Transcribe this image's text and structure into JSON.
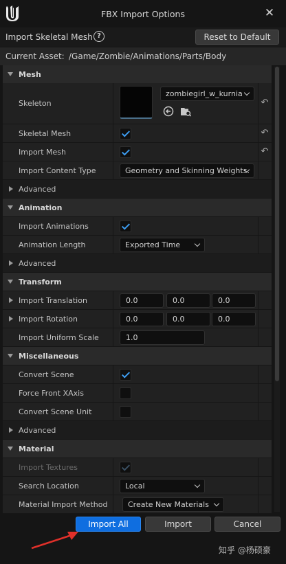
{
  "window": {
    "title": "FBX Import Options",
    "close_glyph": "✕"
  },
  "header": {
    "title": "Import Skeletal Mesh",
    "help_glyph": "?",
    "reset_label": "Reset to Default"
  },
  "asset": {
    "label": "Current Asset:",
    "path": "/Game/Zombie/Animations/Parts/Body"
  },
  "mesh": {
    "section": "Mesh",
    "skeleton_label": "Skeleton",
    "skeleton_value": "zombiegirl_w_kurnia",
    "skeletal_mesh_label": "Skeletal Mesh",
    "skeletal_mesh_checked": true,
    "import_mesh_label": "Import Mesh",
    "import_mesh_checked": true,
    "content_type_label": "Import Content Type",
    "content_type_value": "Geometry and Skinning Weights.",
    "advanced": "Advanced"
  },
  "animation": {
    "section": "Animation",
    "import_anims_label": "Import Animations",
    "import_anims_checked": true,
    "length_label": "Animation Length",
    "length_value": "Exported Time",
    "advanced": "Advanced"
  },
  "transform": {
    "section": "Transform",
    "translation_label": "Import Translation",
    "translation": [
      "0.0",
      "0.0",
      "0.0"
    ],
    "rotation_label": "Import Rotation",
    "rotation": [
      "0.0",
      "0.0",
      "0.0"
    ],
    "scale_label": "Import Uniform Scale",
    "scale": "1.0"
  },
  "misc": {
    "section": "Miscellaneous",
    "convert_scene_label": "Convert Scene",
    "convert_scene_checked": true,
    "force_front_label": "Force Front XAxis",
    "force_front_checked": false,
    "convert_unit_label": "Convert Scene Unit",
    "convert_unit_checked": false,
    "advanced": "Advanced"
  },
  "material": {
    "section": "Material",
    "import_textures_label": "Import Textures",
    "import_textures_checked": true,
    "search_location_label": "Search Location",
    "search_location_value": "Local",
    "import_method_label": "Material Import Method",
    "import_method_value": "Create New Materials"
  },
  "footer": {
    "import_all": "Import All",
    "import": "Import",
    "cancel": "Cancel"
  },
  "icons": {
    "reset_arrow": "↶",
    "accent": "#0f6ee0",
    "check_color": "#3d9cf0",
    "annotation_arrow_color": "#e0302a"
  },
  "watermark": "知乎 @杨硕豪"
}
